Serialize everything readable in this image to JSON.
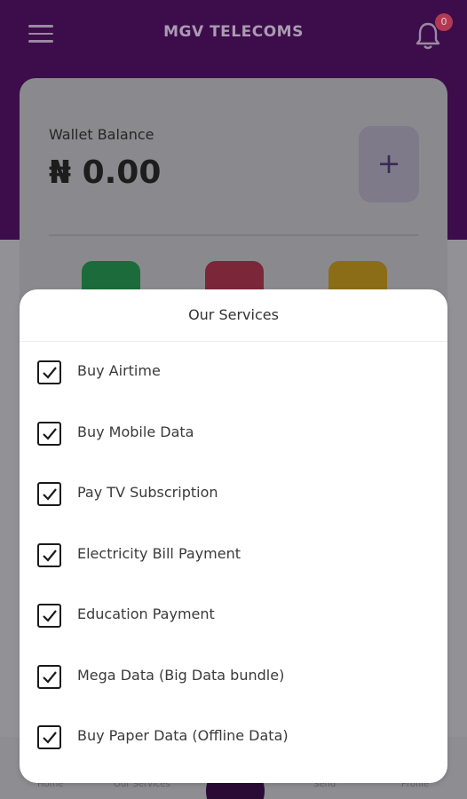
{
  "header": {
    "title": "MGV TELECOMS",
    "notification_count": "0"
  },
  "wallet": {
    "label": "Wallet Balance",
    "amount": "₦ 0.00",
    "add_symbol": "+"
  },
  "services_sheet": {
    "title": "Our Services",
    "items": [
      {
        "label": "Buy Airtime",
        "checked": true
      },
      {
        "label": "Buy Mobile Data",
        "checked": true
      },
      {
        "label": "Pay TV Subscription",
        "checked": true
      },
      {
        "label": "Electricity Bill Payment",
        "checked": true
      },
      {
        "label": "Education Payment",
        "checked": true
      },
      {
        "label": "Mega Data (Big Data bundle)",
        "checked": true
      },
      {
        "label": "Buy Paper Data (Offline Data)",
        "checked": true
      }
    ]
  },
  "bottom_nav": {
    "home": "Home",
    "services": "Our Services",
    "send": "Send",
    "profile": "Profile"
  },
  "colors": {
    "header_bg": "#3c0d4a",
    "badge": "#b13a52",
    "green": "#1c6b3a",
    "red": "#7b2639",
    "yellow": "#8a6d16"
  }
}
